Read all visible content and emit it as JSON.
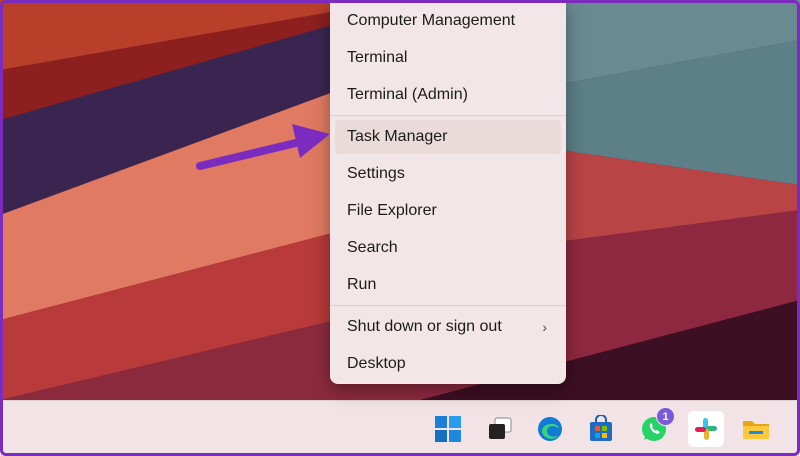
{
  "context_menu": {
    "items": [
      {
        "label": "Computer Management"
      },
      {
        "label": "Terminal"
      },
      {
        "label": "Terminal (Admin)"
      },
      {
        "label": "Task Manager",
        "highlighted": true
      },
      {
        "label": "Settings"
      },
      {
        "label": "File Explorer"
      },
      {
        "label": "Search"
      },
      {
        "label": "Run"
      },
      {
        "label": "Shut down or sign out",
        "has_submenu": true
      },
      {
        "label": "Desktop"
      }
    ],
    "submenu_glyph": "›"
  },
  "annotation": {
    "arrow_color": "#7b2cbf",
    "points_to": "Task Manager"
  },
  "taskbar": {
    "icons": [
      {
        "name": "windows-start-icon"
      },
      {
        "name": "task-view-icon"
      },
      {
        "name": "edge-icon"
      },
      {
        "name": "microsoft-store-icon"
      },
      {
        "name": "whatsapp-icon",
        "badge": "1"
      },
      {
        "name": "slack-icon"
      },
      {
        "name": "file-explorer-icon"
      }
    ]
  },
  "colors": {
    "accent": "#7b2cbf",
    "menu_bg": "#f3e6e8",
    "taskbar_bg": "#f2e4e6"
  }
}
